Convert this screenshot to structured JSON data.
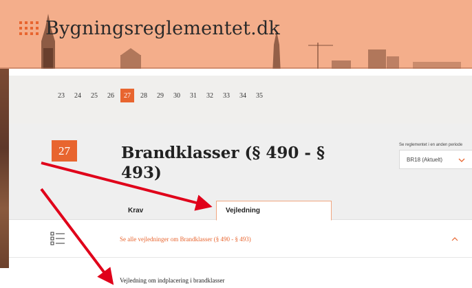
{
  "site": {
    "title": "Bygningsreglementet.dk"
  },
  "pager": {
    "pages": [
      "23",
      "24",
      "25",
      "26",
      "27",
      "28",
      "29",
      "30",
      "31",
      "32",
      "33",
      "34",
      "35"
    ],
    "active": "27"
  },
  "chapter": {
    "number": "27",
    "title": "Brandklasser (§ 490 - § 493)"
  },
  "period": {
    "label": "Se reglementet i en anden periode",
    "selected": "BR18 (Aktuelt)"
  },
  "tabs": [
    {
      "label": "Krav",
      "active": false
    },
    {
      "label": "Vejledning",
      "active": true
    }
  ],
  "accordion": {
    "label": "Se alle vejledninger om Brandklasser (§ 490 - § 493)"
  },
  "guide": {
    "link": "Vejledning om indplacering i brandklasser"
  },
  "colors": {
    "accent": "#e8652f",
    "arrow": "#e0001a",
    "hero": "#f4ae8b"
  }
}
